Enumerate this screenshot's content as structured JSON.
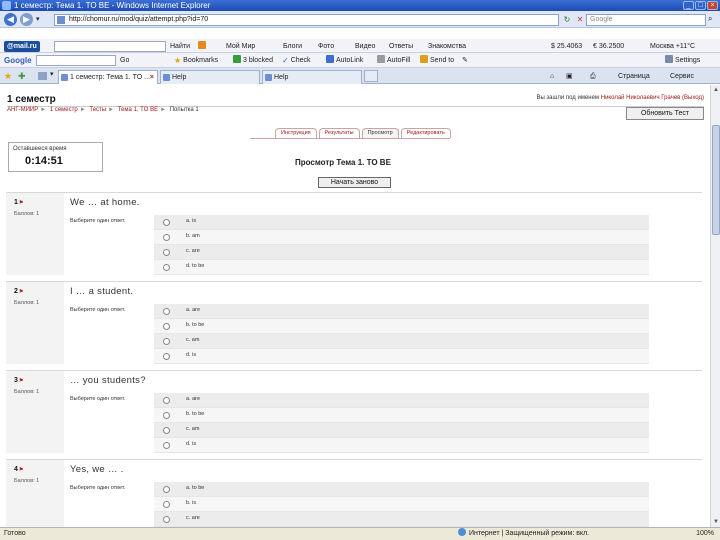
{
  "window": {
    "title": "1 семестр: Тема 1. TO BE - Windows Internet Explorer"
  },
  "address": {
    "url": "http://chomur.ru/mod/quiz/attempt.php?id=70",
    "search_placeholder": "Google"
  },
  "toolbar1": {
    "mail_logo": "@mail.ru",
    "search_button": "Найти",
    "moi_mir": "Мой Мир",
    "blogi": "Блоги",
    "foto": "Фото",
    "video": "Видео",
    "otvety": "Ответы",
    "znakomstva": "Знакомства",
    "usd": "$ 25.4063",
    "eur": "€ 36.2500",
    "weather": "Москва +11°C"
  },
  "toolbar2": {
    "google_logo": "Google",
    "go_button": "Go",
    "bookmarks": "Bookmarks",
    "blocked": "3 blocked",
    "check": "Check",
    "autolink": "AutoLink",
    "autofill": "AutoFill",
    "send_to": "Send to",
    "settings": "Settings"
  },
  "tabs": [
    {
      "label": "1 семестр: Тема 1. TO ..."
    },
    {
      "label": "Help"
    },
    {
      "label": "Help"
    }
  ],
  "command_bar": {
    "page": "Страница",
    "tools": "Сервис"
  },
  "page": {
    "course_title": "1 семестр",
    "login_prefix": "Вы зашли под именем",
    "login_user": "Николай Николаевич Грачев",
    "login_suffix": "(Выход)",
    "breadcrumbs": [
      "АНГ-МИИР",
      "1 семестр",
      "Тесты",
      "Тема 1. TO BE",
      "Попытка 1"
    ],
    "update_button": "Обновить Тест",
    "quiz_tabs": [
      "Инструкция",
      "Результаты",
      "Просмотр",
      "Редактировать"
    ],
    "current_tab_index": 2,
    "timer_label": "Оставшееся время",
    "timer_value": "0:14:51",
    "preview_title": "Просмотр Тема 1. TO BE",
    "restart_button": "Начать заново"
  },
  "questions": [
    {
      "number": "1",
      "marks": "Баллов: 1",
      "text": "We … at home.",
      "prompt": "Выберите один ответ.",
      "answers": [
        "a. is",
        "b. am",
        "c. are",
        "d. to be"
      ]
    },
    {
      "number": "2",
      "marks": "Баллов: 1",
      "text": "I … a student.",
      "prompt": "Выберите один ответ.",
      "answers": [
        "a. are",
        "b. to be",
        "c. am",
        "d. is"
      ]
    },
    {
      "number": "3",
      "marks": "Баллов: 1",
      "text": "… you students?",
      "prompt": "Выберите один ответ.",
      "answers": [
        "a. are",
        "b. to be",
        "c. am",
        "d. is"
      ]
    },
    {
      "number": "4",
      "marks": "Баллов: 1",
      "text": "Yes, we … .",
      "prompt": "Выберите один ответ.",
      "answers": [
        "a. to be",
        "b. is",
        "c. are"
      ]
    }
  ],
  "statusbar": {
    "status": "Готово",
    "zone": "Интернет | Защищенный режим: вкл.",
    "zoom": "100%"
  }
}
